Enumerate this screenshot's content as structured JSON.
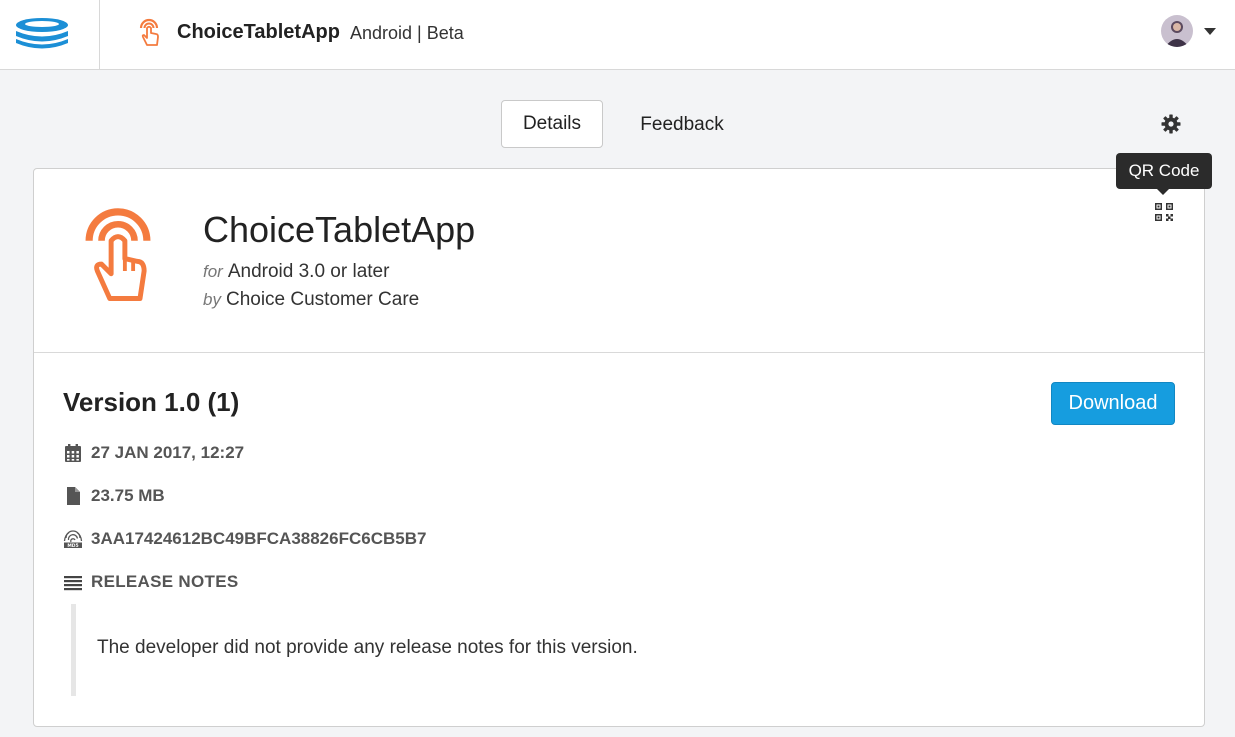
{
  "header": {
    "logo_icon": "database-stack-logo",
    "app_icon": "touch-hand-icon",
    "app_name": "ChoiceTabletApp",
    "platform_meta": "Android | Beta",
    "avatar": "user-avatar",
    "menu_icon": "caret-down-icon"
  },
  "tabs": [
    {
      "label": "Details",
      "active": true
    },
    {
      "label": "Feedback",
      "active": false
    }
  ],
  "settings_icon": "gear-icon",
  "app_card": {
    "title": "ChoiceTabletApp",
    "for_prefix": "for",
    "for_value": "Android 3.0 or later",
    "by_prefix": "by",
    "by_value": "Choice Customer Care",
    "qr_icon": "qr-code-icon",
    "tooltip": "QR Code",
    "accent_color": "#f47b3f"
  },
  "release": {
    "version": "Version 1.0 (1)",
    "download_label": "Download",
    "download_color": "#169ddf",
    "date": "27 JAN 2017, 12:27",
    "size": "23.75 MB",
    "hash": "3AA17424612BC49BFCA38826FC6CB5B7",
    "notes_heading": "RELEASE NOTES",
    "notes_text": "The developer did not provide any release notes for this version."
  }
}
